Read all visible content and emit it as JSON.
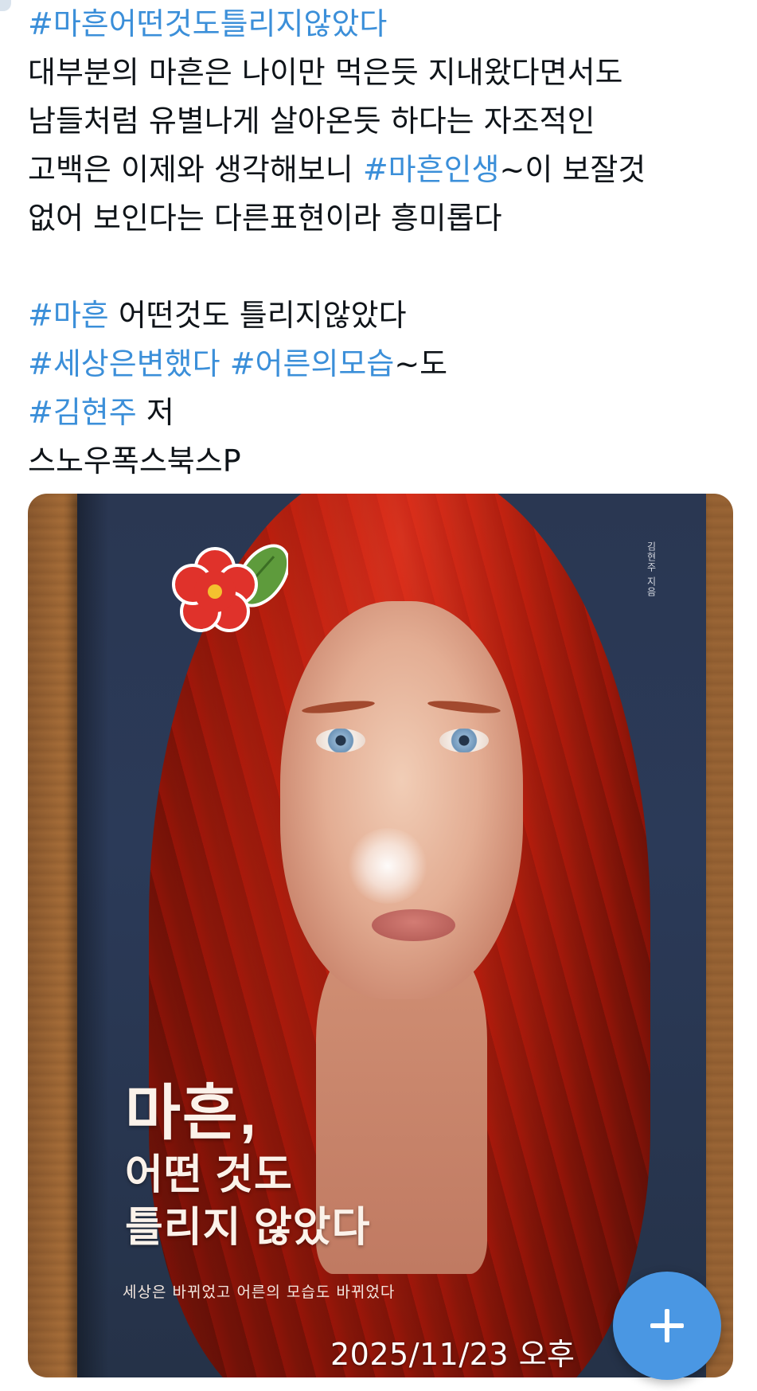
{
  "post": {
    "lines": [
      [
        {
          "t": "#마흔어떤것도틀리지않았다",
          "tag": true
        }
      ],
      [
        {
          "t": "대부분의 마흔은 나이만 먹은듯 지내왔다면서도",
          "tag": false
        }
      ],
      [
        {
          "t": "남들처럼 유별나게 살아온듯 하다는 자조적인",
          "tag": false
        }
      ],
      [
        {
          "t": "고백은 이제와 생각해보니 ",
          "tag": false
        },
        {
          "t": "#마흔인생",
          "tag": true
        },
        {
          "t": "~이 보잘것",
          "tag": false
        }
      ],
      [
        {
          "t": "없어 보인다는 다른표현이라 흥미롭다",
          "tag": false
        }
      ],
      [],
      [
        {
          "t": "#마흔",
          "tag": true
        },
        {
          "t": " 어떤것도 틀리지않았다",
          "tag": false
        }
      ],
      [
        {
          "t": "#세상은변했다",
          "tag": true
        },
        {
          "t": " ",
          "tag": false
        },
        {
          "t": "#어른의모습",
          "tag": true
        },
        {
          "t": "~도",
          "tag": false
        }
      ],
      [
        {
          "t": "#김현주",
          "tag": true
        },
        {
          "t": " 저",
          "tag": false
        }
      ],
      [
        {
          "t": "스노우폭스북스P",
          "tag": false
        }
      ]
    ]
  },
  "media": {
    "cover_author_vertical": "김현주 지음",
    "cover_title_line1": "마흔,",
    "cover_title_line2": "어떤 것도",
    "cover_title_line3": "틀리지 않았다",
    "cover_subtitle": "세상은 바뀌었고 어른의 모습도 바뀌었다",
    "timestamp": "2025/11/23 오후"
  },
  "compose_button": {
    "icon": "plus-icon"
  },
  "colors": {
    "hashtag": "#3b8fd9",
    "text": "#0f1419",
    "fab": "#4a97e3"
  }
}
